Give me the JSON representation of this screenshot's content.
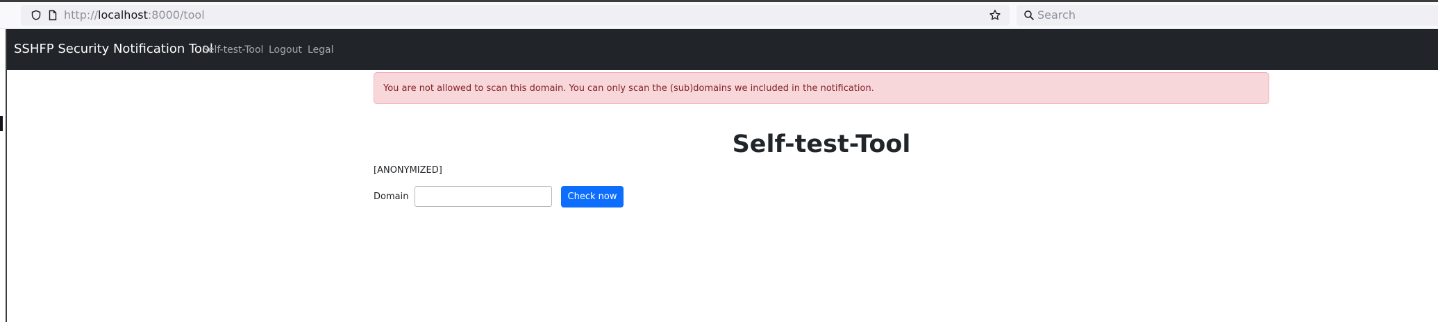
{
  "browser": {
    "url_prefix": "http://",
    "url_host": "localhost",
    "url_rest": ":8000/tool",
    "search_placeholder": "Search"
  },
  "navbar": {
    "brand": "SSHFP Security Notification Tool",
    "links": [
      "Self-test-Tool",
      "Logout",
      "Legal"
    ]
  },
  "alert": {
    "message": "You are not allowed to scan this domain. You can only scan the (sub)domains we included in the notification."
  },
  "main": {
    "title": "Self-test-Tool",
    "anonymized": "[ANONYMIZED]",
    "domain_label": "Domain",
    "domain_value": "",
    "check_button": "Check now"
  },
  "colors": {
    "navbar_bg": "#212529",
    "alert_bg": "#f8d7da",
    "alert_text": "#842029",
    "button_bg": "#0d6efd"
  }
}
